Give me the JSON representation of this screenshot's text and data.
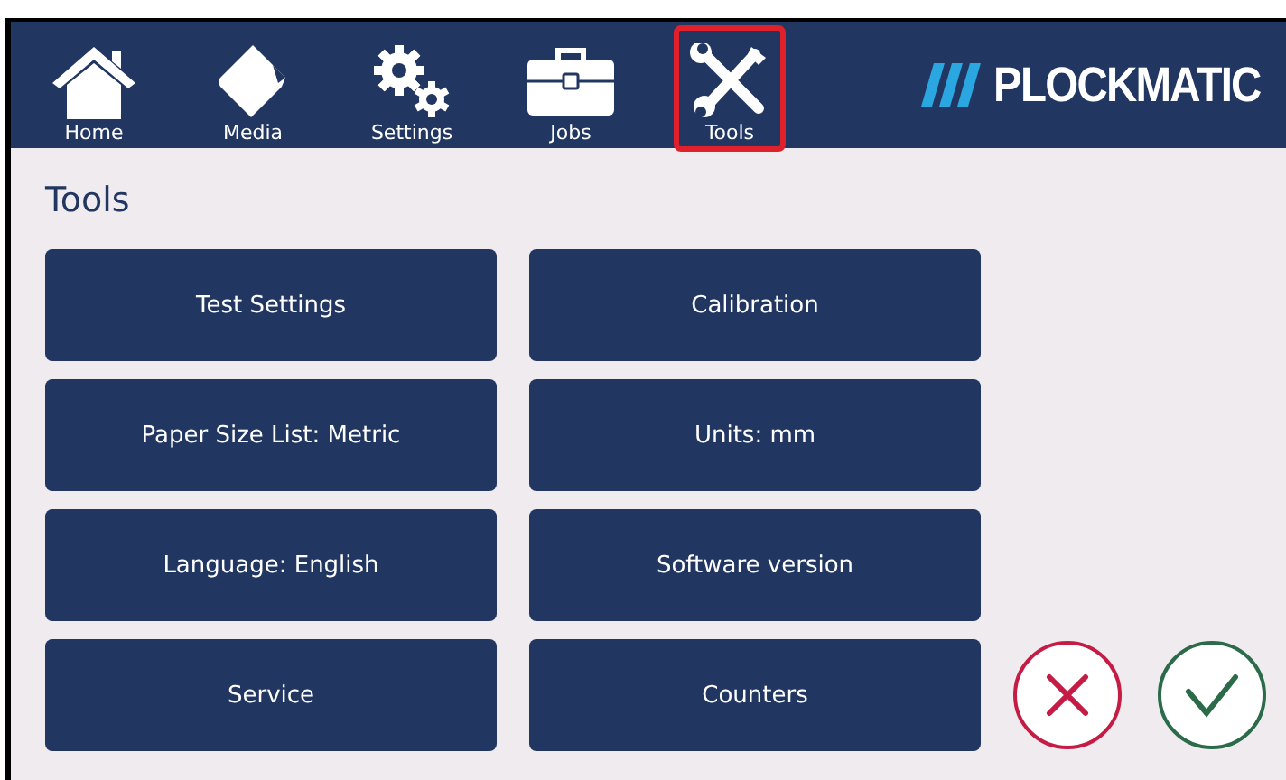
{
  "nav": [
    {
      "kind": "home",
      "label": "Home",
      "selected": false
    },
    {
      "kind": "media",
      "label": "Media",
      "selected": false
    },
    {
      "kind": "settings",
      "label": "Settings",
      "selected": false
    },
    {
      "kind": "jobs",
      "label": "Jobs",
      "selected": false
    },
    {
      "kind": "tools",
      "label": "Tools",
      "selected": true
    }
  ],
  "brand": "PLOCKMATIC",
  "page_title": "Tools",
  "buttons": [
    {
      "label": "Test Settings"
    },
    {
      "label": "Calibration"
    },
    {
      "label": "Paper Size List: Metric"
    },
    {
      "label": "Units: mm"
    },
    {
      "label": "Language: English"
    },
    {
      "label": "Software version"
    },
    {
      "label": "Service"
    },
    {
      "label": "Counters"
    }
  ],
  "actions": [
    {
      "kind": "cancel"
    },
    {
      "kind": "confirm"
    }
  ]
}
